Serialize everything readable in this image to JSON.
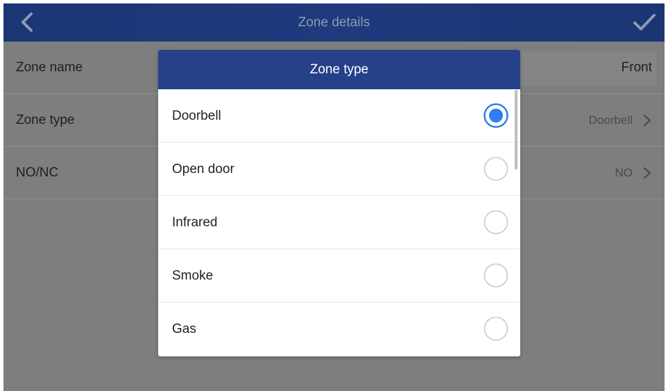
{
  "header": {
    "title": "Zone details",
    "back_icon": "chevron-left-icon",
    "confirm_icon": "checkmark-icon"
  },
  "settings": {
    "rows": [
      {
        "label": "Zone name",
        "value": "Front"
      },
      {
        "label": "Zone type",
        "value": "Doorbell"
      },
      {
        "label": "NO/NC",
        "value": "NO"
      }
    ]
  },
  "dialog": {
    "title": "Zone type",
    "options": [
      {
        "label": "Doorbell",
        "selected": true
      },
      {
        "label": "Open door",
        "selected": false
      },
      {
        "label": "Infrared",
        "selected": false
      },
      {
        "label": "Smoke",
        "selected": false
      },
      {
        "label": "Gas",
        "selected": false
      }
    ]
  },
  "colors": {
    "header_bg": "#1f3b7d",
    "dialog_header_bg": "#25418a",
    "radio_selected": "#2f7cf6",
    "radio_unselected": "#c8c8c8",
    "overlay_bg": "#7e7e7e"
  }
}
